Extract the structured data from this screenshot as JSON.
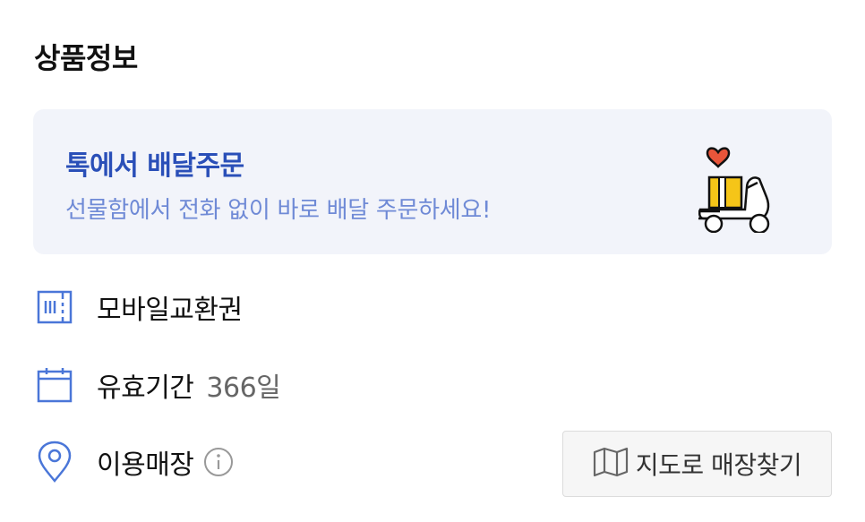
{
  "section": {
    "title": "상품정보"
  },
  "banner": {
    "title": "톡에서 배달주문",
    "subtitle": "선물함에서 전화 없이 바로 배달 주문하세요!",
    "icon": "delivery-scooter-gift-icon"
  },
  "rows": [
    {
      "icon": "ticket-icon",
      "label": "모바일교환권"
    },
    {
      "icon": "calendar-icon",
      "label": "유효기간",
      "value": "366일"
    },
    {
      "icon": "location-pin-icon",
      "label": "이용매장",
      "info_icon": "info-icon"
    }
  ],
  "map_button": {
    "icon": "map-icon",
    "label": "지도로 매장찾기"
  },
  "colors": {
    "accent": "#2a4fb8",
    "banner_bg": "#f2f4fa",
    "icon_blue": "#4a76d8",
    "heart": "#e8553a",
    "gift": "#f5c518"
  }
}
